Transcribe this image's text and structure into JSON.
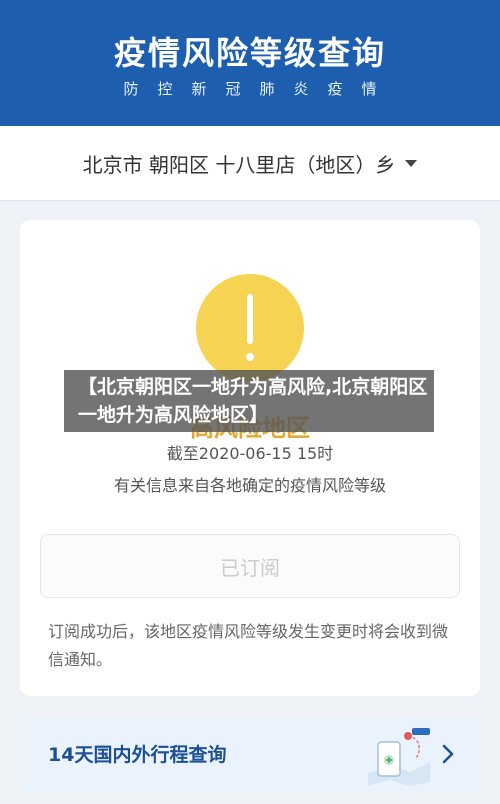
{
  "header": {
    "title": "疫情风险等级查询",
    "subtitle": "防控新冠肺炎疫情"
  },
  "location": {
    "text": "北京市  朝阳区  十八里店（地区）乡"
  },
  "risk": {
    "level": "高风险地区",
    "as_of": "截至2020-06-15 15时",
    "note": "有关信息来自各地确定的疫情风险等级"
  },
  "subscribe": {
    "button_label": "已订阅",
    "message": "订阅成功后，该地区疫情风险等级发生变更时将会收到微信通知。"
  },
  "trip": {
    "label": "14天国内外行程查询"
  },
  "overlay": {
    "caption": "【北京朝阳区一地升为高风险,北京朝阳区一地升为高风险地区】"
  },
  "colors": {
    "header_bg": "#1d5fae",
    "warning_yellow": "#f6d352",
    "accent_blue": "#1d4f94"
  },
  "icons": {
    "warning": "exclamation-icon",
    "dropdown": "caret-down-icon",
    "trip": "map-route-icon",
    "next": "chevron-right-icon"
  }
}
